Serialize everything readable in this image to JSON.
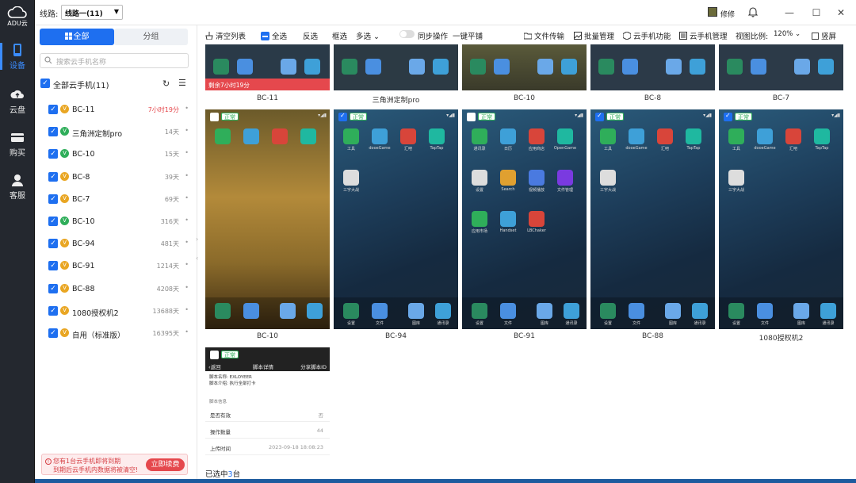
{
  "app": {
    "logo_text": "ADU云",
    "colors": {
      "accent": "#1e6ff0",
      "rail": "#24282f",
      "danger": "#e5484d",
      "ok": "#2fae5a"
    }
  },
  "rail": {
    "items": [
      {
        "label": "设备",
        "icon": "phone-icon"
      },
      {
        "label": "云盘",
        "icon": "cloud-upload-icon"
      },
      {
        "label": "购买",
        "icon": "card-icon"
      },
      {
        "label": "客服",
        "icon": "support-icon"
      }
    ]
  },
  "titlebar": {
    "route_label": "线路:",
    "route_value": "线路一(11)",
    "user_name": "修修",
    "min": "—",
    "max": "☐",
    "close": "✕"
  },
  "side": {
    "tab_all": "全部",
    "tab_group": "分组",
    "search_placeholder": "搜索云手机名称",
    "all_label": "全部云手机(11)",
    "devices": [
      {
        "name": "BC-11",
        "days": "7小时19分",
        "vip": "v"
      },
      {
        "name": "三角洲定制pro",
        "days": "14天",
        "vip": "g"
      },
      {
        "name": "BC-10",
        "days": "15天",
        "vip": "g"
      },
      {
        "name": "BC-8",
        "days": "39天",
        "vip": "v"
      },
      {
        "name": "BC-7",
        "days": "69天",
        "vip": "v"
      },
      {
        "name": "BC-10",
        "days": "316天",
        "vip": "g"
      },
      {
        "name": "BC-94",
        "days": "481天",
        "vip": "v"
      },
      {
        "name": "BC-91",
        "days": "1214天",
        "vip": "v"
      },
      {
        "name": "BC-88",
        "days": "4208天",
        "vip": "v"
      },
      {
        "name": "1080授权机2",
        "days": "13688天",
        "vip": "v"
      },
      {
        "name": "自用（标准版）",
        "days": "16395天",
        "vip": "v"
      }
    ],
    "renew_line1": "您有1台云手机即将到期",
    "renew_line2": "到期后云手机内数据将被清空!",
    "renew_button": "立即续费"
  },
  "toolbar": {
    "clear": "清空列表",
    "select_all": "全选",
    "invert": "反选",
    "box_select": "框选",
    "multi": "多选",
    "sync": "同步操作",
    "tile": "一键平铺",
    "file": "文件传输",
    "batch": "批量管理",
    "cloud_func": "云手机功能",
    "cloud_manage": "云手机管理",
    "ratio_label": "视图比例:",
    "ratio_value": "120%",
    "portrait": "竖屏"
  },
  "grid": {
    "top_row": [
      {
        "name": "BC-11",
        "expired": "剩余7小时19分"
      },
      {
        "name": "三角洲定制pro"
      },
      {
        "name": "BC-10"
      },
      {
        "name": "BC-8"
      },
      {
        "name": "BC-7"
      }
    ],
    "phones": [
      {
        "name": "BC-10",
        "tag": "正常",
        "checked": false
      },
      {
        "name": "BC-94",
        "tag": "正常",
        "checked": true
      },
      {
        "name": "BC-91",
        "tag": "正常",
        "checked": false
      },
      {
        "name": "BC-88",
        "tag": "正常",
        "checked": true
      },
      {
        "name": "1080授权机2",
        "tag": "正常",
        "checked": true
      }
    ],
    "third": {
      "tag": "正常",
      "back": "返回",
      "title": "脚本详情",
      "link": "分享脚本ID",
      "line1": "脚本名称: EXLOYEER",
      "line2": "脚本介绍: 执行全部打卡",
      "section": "脚本信息",
      "rows": [
        {
          "k": "是否有效",
          "v": "否"
        },
        {
          "k": "操作数量",
          "v": "44"
        },
        {
          "k": "上传时间",
          "v": "2023-09-18 18:08:23"
        }
      ]
    },
    "apps_bc94": [
      "工具",
      "dooeGame",
      "汇吧",
      "TapTap",
      "三宇大战"
    ],
    "apps_bc91": [
      "通讯录",
      "日历",
      "应用商店",
      "OpenGame",
      "设置",
      "Search",
      "视频播放",
      "文件管理",
      "应用市场",
      "Handset",
      "LBChaker"
    ],
    "dock": [
      "设置",
      "文件",
      "图库",
      "通讯录"
    ]
  },
  "status": {
    "selected_prefix": "已选中",
    "selected_count": "3",
    "selected_suffix": "台"
  }
}
